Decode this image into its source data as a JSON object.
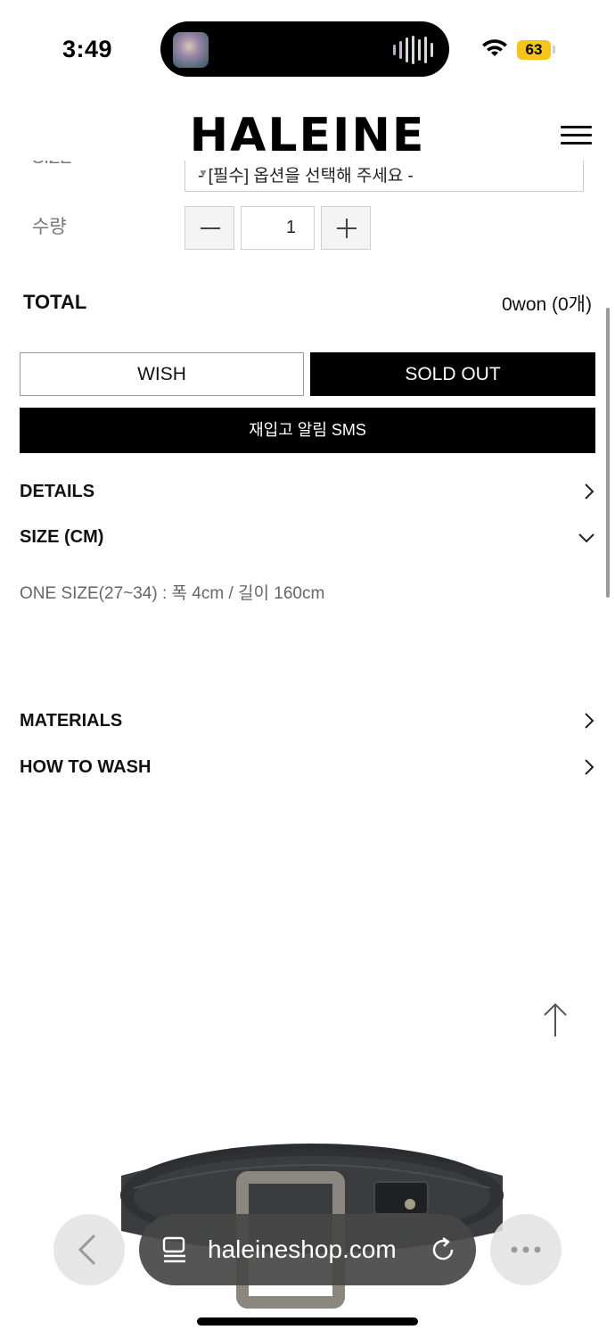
{
  "status_bar": {
    "time": "3:49",
    "battery": "63",
    "battery_color": "#f5c518"
  },
  "header": {
    "logo": "HALEINE",
    "menu_icon": "hamburger-menu-icon"
  },
  "product_options": {
    "option_label": "SIZE",
    "option_select_value": "- [필수] 옵션을 선택해 주세요 -",
    "quantity_label": "수량",
    "quantity_value": "1"
  },
  "total": {
    "label": "TOTAL",
    "value": "0won (0개)"
  },
  "buttons": {
    "wish": "WISH",
    "sold_out": "SOLD OUT",
    "restock_sms": "재입고 알림 SMS"
  },
  "accordions": {
    "details": {
      "title": "DETAILS",
      "icon": "chevron-right-icon"
    },
    "size": {
      "title": "SIZE (CM)",
      "icon": "chevron-down-icon",
      "content": "ONE SIZE(27~34) : 폭 4cm / 길이 160cm"
    },
    "materials": {
      "title": "MATERIALS",
      "icon": "chevron-right-icon"
    },
    "how_to_wash": {
      "title": "HOW TO WASH",
      "icon": "chevron-right-icon"
    }
  },
  "scroll_top_icon": "arrow-up-icon",
  "browser": {
    "url": "haleineshop.com",
    "back_icon": "chevron-left-icon",
    "more_icon": "ellipsis-icon"
  },
  "colors": {
    "primary": "#000000",
    "background": "#ffffff",
    "muted_text": "#777777"
  }
}
